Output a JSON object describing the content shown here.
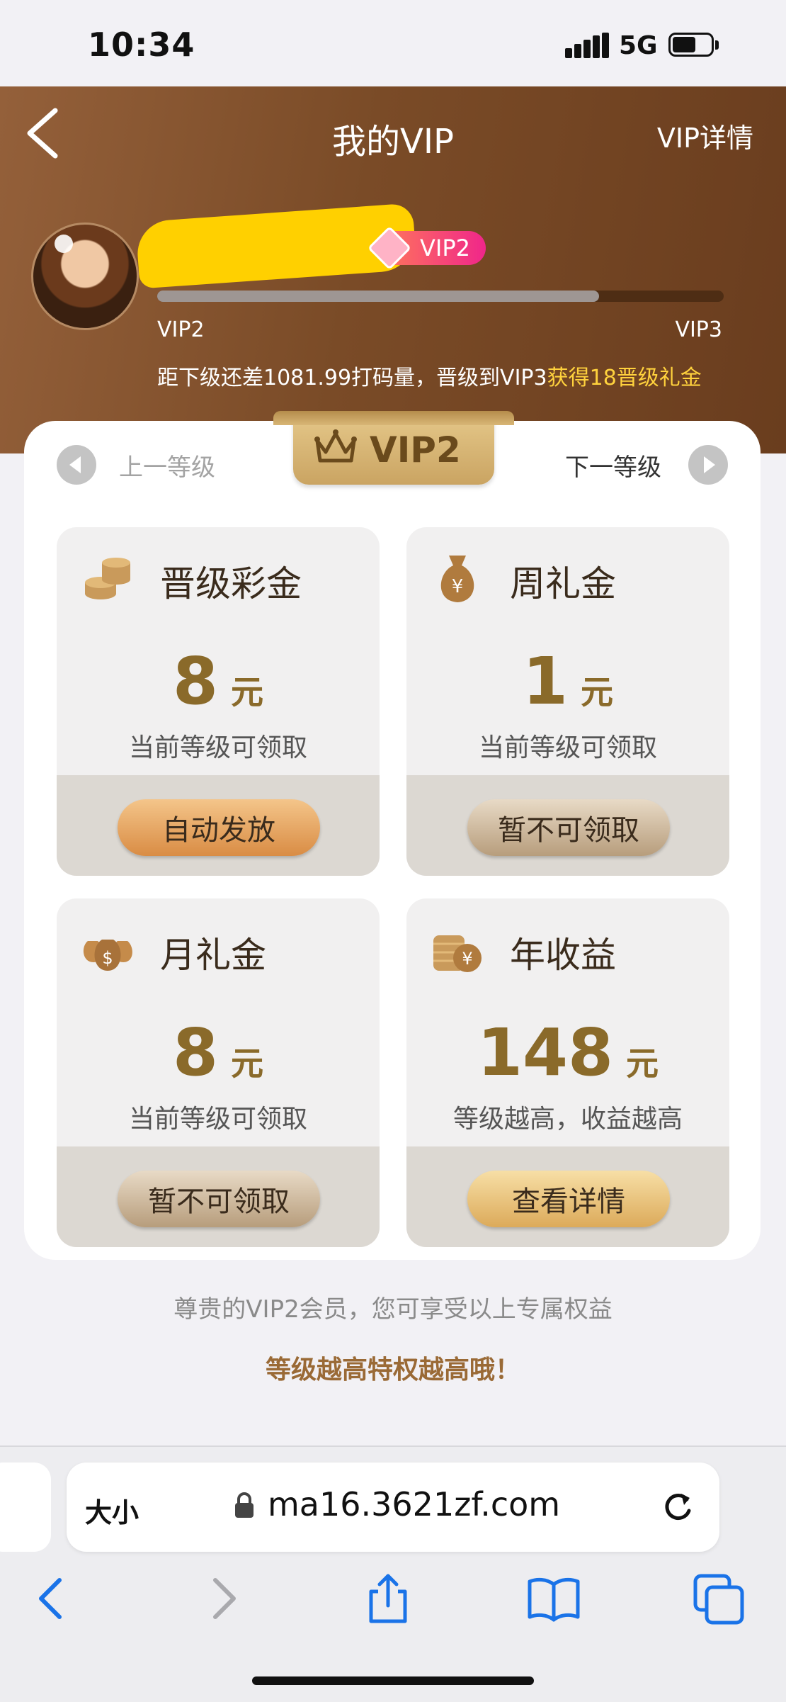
{
  "status_bar": {
    "time": "10:34",
    "network": "5G"
  },
  "header": {
    "title": "我的VIP",
    "detail_link": "VIP详情",
    "badge": "VIP2",
    "progress": 0.78,
    "current_level": "VIP2",
    "next_level": "VIP3",
    "note_prefix": "距下级还差1081.99打码量，晋级到VIP3",
    "note_highlight": "获得18晋级礼金"
  },
  "level_switcher": {
    "current": "VIP2",
    "prev_label": "上一等级",
    "next_label": "下一等级"
  },
  "benefits": [
    {
      "title": "晋级彩金",
      "value": "8",
      "unit": "元",
      "desc": "当前等级可领取",
      "button": "自动发放",
      "icon": "coin-stack-icon"
    },
    {
      "title": "周礼金",
      "value": "1",
      "unit": "元",
      "desc": "当前等级可领取",
      "button": "暂不可领取",
      "icon": "money-bag-yen-icon"
    },
    {
      "title": "月礼金",
      "value": "8",
      "unit": "元",
      "desc": "当前等级可领取",
      "button": "暂不可领取",
      "icon": "money-bags-dollar-icon"
    },
    {
      "title": "年收益",
      "value": "148",
      "unit": "元",
      "desc": "等级越高，收益越高",
      "button": "查看详情",
      "icon": "coin-yen-icon"
    }
  ],
  "footer": {
    "note": "尊贵的VIP2会员，您可享受以上专属权益",
    "slogan": "等级越高特权越高哦！"
  },
  "browser": {
    "text_size_label": "大小",
    "url": "ma16.3621zf.com"
  },
  "colors": {
    "header_brown": "#7a4b27",
    "accent_gold": "#ffd23d",
    "value_gold": "#8a6a2a",
    "badge_pink": "#f0268a"
  }
}
